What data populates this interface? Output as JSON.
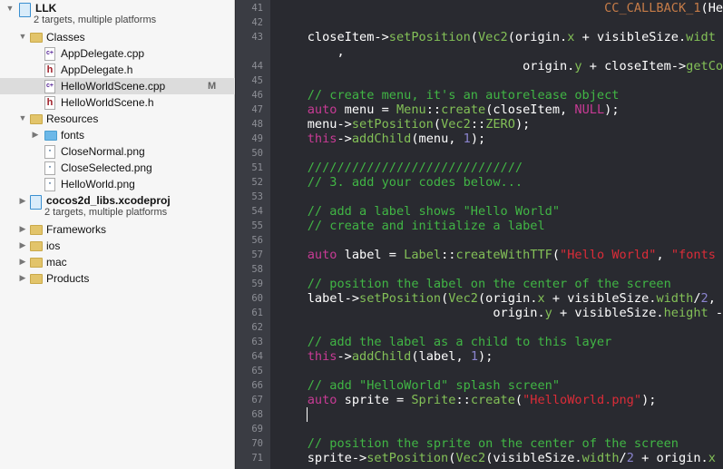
{
  "navigator": {
    "items": [
      {
        "label": "LLK",
        "subtitle": "2 targets, multiple platforms",
        "icon": "project-icon",
        "level": 0,
        "disclosure": "open",
        "bold": true
      },
      {
        "label": "Classes",
        "icon": "folder-icon",
        "level": 1,
        "disclosure": "open"
      },
      {
        "label": "AppDelegate.cpp",
        "icon": "cpp-file-icon",
        "level": 2
      },
      {
        "label": "AppDelegate.h",
        "icon": "header-file-icon",
        "level": 2
      },
      {
        "label": "HelloWorldScene.cpp",
        "icon": "cpp-file-icon",
        "level": 2,
        "selected": true,
        "badge": "M"
      },
      {
        "label": "HelloWorldScene.h",
        "icon": "header-file-icon",
        "level": 2
      },
      {
        "label": "Resources",
        "icon": "folder-icon",
        "level": 1,
        "disclosure": "open"
      },
      {
        "label": "fonts",
        "icon": "blue-folder-icon",
        "level": 2,
        "disclosure": "closed"
      },
      {
        "label": "CloseNormal.png",
        "icon": "image-file-icon",
        "level": 2
      },
      {
        "label": "CloseSelected.png",
        "icon": "image-file-icon",
        "level": 2
      },
      {
        "label": "HelloWorld.png",
        "icon": "image-file-icon",
        "level": 2
      },
      {
        "label": "cocos2d_libs.xcodeproj",
        "subtitle": "2 targets, multiple platforms",
        "icon": "project-icon",
        "level": 1,
        "disclosure": "closed",
        "bold": true
      },
      {
        "label": "Frameworks",
        "icon": "folder-icon",
        "level": 1,
        "disclosure": "closed"
      },
      {
        "label": "ios",
        "icon": "folder-icon",
        "level": 1,
        "disclosure": "closed"
      },
      {
        "label": "mac",
        "icon": "folder-icon",
        "level": 1,
        "disclosure": "closed"
      },
      {
        "label": "Products",
        "icon": "folder-icon",
        "level": 1,
        "disclosure": "closed"
      }
    ]
  },
  "editor": {
    "colors": {
      "background": "#292a30",
      "comment": "#41b645",
      "keyword": "#c83b95",
      "function": "#83c057",
      "string": "#db2c38",
      "number": "#8b84cf",
      "macro": "#c67c48"
    },
    "lines": [
      {
        "num": "41",
        "tokens": [
          [
            "pl",
            "                                            "
          ],
          [
            "mc",
            "CC_CALLBACK_1"
          ],
          [
            "pl",
            "(He"
          ]
        ]
      },
      {
        "num": "42",
        "tokens": []
      },
      {
        "num": "43",
        "tokens": [
          [
            "pl",
            "    closeItem->"
          ],
          [
            "fn",
            "setPosition"
          ],
          [
            "pl",
            "("
          ],
          [
            "fn",
            "Vec2"
          ],
          [
            "pl",
            "(origin."
          ],
          [
            "fn",
            "x"
          ],
          [
            "pl",
            " + visibleSize."
          ],
          [
            "fn",
            "widt"
          ]
        ]
      },
      {
        "num": "",
        "tokens": [
          [
            "pl",
            "        ,"
          ]
        ]
      },
      {
        "num": "44",
        "tokens": [
          [
            "pl",
            "                                 origin."
          ],
          [
            "fn",
            "y"
          ],
          [
            "pl",
            " + closeItem->"
          ],
          [
            "fn",
            "getCo"
          ]
        ]
      },
      {
        "num": "45",
        "tokens": []
      },
      {
        "num": "46",
        "tokens": [
          [
            "cm",
            "    // create menu, it's an autorelease object"
          ]
        ]
      },
      {
        "num": "47",
        "tokens": [
          [
            "kw",
            "    auto"
          ],
          [
            "pl",
            " menu = "
          ],
          [
            "fn",
            "Menu"
          ],
          [
            "pl",
            "::"
          ],
          [
            "fn",
            "create"
          ],
          [
            "pl",
            "(closeItem, "
          ],
          [
            "kw",
            "NULL"
          ],
          [
            "pl",
            ");"
          ]
        ]
      },
      {
        "num": "48",
        "tokens": [
          [
            "pl",
            "    menu->"
          ],
          [
            "fn",
            "setPosition"
          ],
          [
            "pl",
            "("
          ],
          [
            "fn",
            "Vec2"
          ],
          [
            "pl",
            "::"
          ],
          [
            "fn",
            "ZERO"
          ],
          [
            "pl",
            ");"
          ]
        ]
      },
      {
        "num": "49",
        "tokens": [
          [
            "kw",
            "    this"
          ],
          [
            "pl",
            "->"
          ],
          [
            "fn",
            "addChild"
          ],
          [
            "pl",
            "(menu, "
          ],
          [
            "nu",
            "1"
          ],
          [
            "pl",
            ");"
          ]
        ]
      },
      {
        "num": "50",
        "tokens": []
      },
      {
        "num": "51",
        "tokens": [
          [
            "cm",
            "    /////////////////////////////"
          ]
        ]
      },
      {
        "num": "52",
        "tokens": [
          [
            "cm",
            "    // 3. add your codes below..."
          ]
        ]
      },
      {
        "num": "53",
        "tokens": []
      },
      {
        "num": "54",
        "tokens": [
          [
            "cm",
            "    // add a label shows \"Hello World\""
          ]
        ]
      },
      {
        "num": "55",
        "tokens": [
          [
            "cm",
            "    // create and initialize a label"
          ]
        ]
      },
      {
        "num": "56",
        "tokens": []
      },
      {
        "num": "57",
        "tokens": [
          [
            "kw",
            "    auto"
          ],
          [
            "pl",
            " label = "
          ],
          [
            "fn",
            "Label"
          ],
          [
            "pl",
            "::"
          ],
          [
            "fn",
            "createWithTTF"
          ],
          [
            "pl",
            "("
          ],
          [
            "st",
            "\"Hello World\""
          ],
          [
            "pl",
            ", "
          ],
          [
            "st",
            "\"fonts"
          ]
        ]
      },
      {
        "num": "58",
        "tokens": []
      },
      {
        "num": "59",
        "tokens": [
          [
            "cm",
            "    // position the label on the center of the screen"
          ]
        ]
      },
      {
        "num": "60",
        "tokens": [
          [
            "pl",
            "    label->"
          ],
          [
            "fn",
            "setPosition"
          ],
          [
            "pl",
            "("
          ],
          [
            "fn",
            "Vec2"
          ],
          [
            "pl",
            "(origin."
          ],
          [
            "fn",
            "x"
          ],
          [
            "pl",
            " + visibleSize."
          ],
          [
            "fn",
            "width"
          ],
          [
            "pl",
            "/"
          ],
          [
            "nu",
            "2"
          ],
          [
            "pl",
            ","
          ]
        ]
      },
      {
        "num": "61",
        "tokens": [
          [
            "pl",
            "                             origin."
          ],
          [
            "fn",
            "y"
          ],
          [
            "pl",
            " + visibleSize."
          ],
          [
            "fn",
            "height"
          ],
          [
            "pl",
            " -"
          ]
        ]
      },
      {
        "num": "62",
        "tokens": []
      },
      {
        "num": "63",
        "tokens": [
          [
            "cm",
            "    // add the label as a child to this layer"
          ]
        ]
      },
      {
        "num": "64",
        "tokens": [
          [
            "kw",
            "    this"
          ],
          [
            "pl",
            "->"
          ],
          [
            "fn",
            "addChild"
          ],
          [
            "pl",
            "(label, "
          ],
          [
            "nu",
            "1"
          ],
          [
            "pl",
            ");"
          ]
        ]
      },
      {
        "num": "65",
        "tokens": []
      },
      {
        "num": "66",
        "tokens": [
          [
            "cm",
            "    // add \"HelloWorld\" splash screen\""
          ]
        ]
      },
      {
        "num": "67",
        "tokens": [
          [
            "kw",
            "    auto"
          ],
          [
            "pl",
            " sprite = "
          ],
          [
            "fn",
            "Sprite"
          ],
          [
            "pl",
            "::"
          ],
          [
            "fn",
            "create"
          ],
          [
            "pl",
            "("
          ],
          [
            "st",
            "\"HelloWorld.png\""
          ],
          [
            "pl",
            ");"
          ]
        ]
      },
      {
        "num": "68",
        "tokens": []
      },
      {
        "num": "69",
        "tokens": []
      },
      {
        "num": "70",
        "tokens": [
          [
            "cm",
            "    // position the sprite on the center of the screen"
          ]
        ]
      },
      {
        "num": "71",
        "tokens": [
          [
            "pl",
            "    sprite->"
          ],
          [
            "fn",
            "setPosition"
          ],
          [
            "pl",
            "("
          ],
          [
            "fn",
            "Vec2"
          ],
          [
            "pl",
            "(visibleSize."
          ],
          [
            "fn",
            "width"
          ],
          [
            "pl",
            "/"
          ],
          [
            "nu",
            "2"
          ],
          [
            "pl",
            " + origin."
          ],
          [
            "fn",
            "x"
          ]
        ]
      }
    ]
  }
}
